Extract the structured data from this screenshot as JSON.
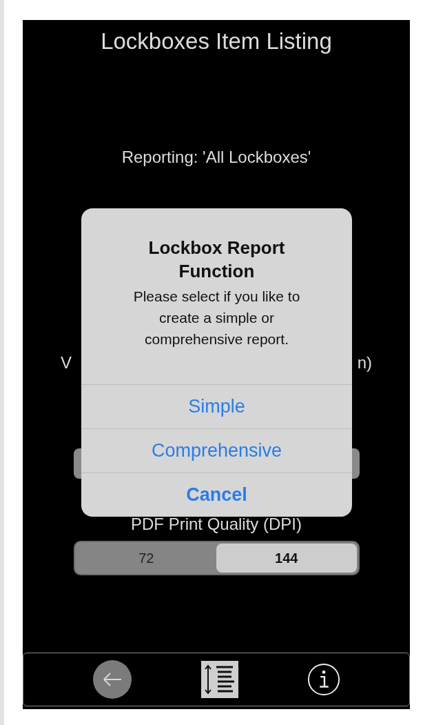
{
  "screen": {
    "title": "Lockboxes Item Listing",
    "reporting": "Reporting: 'All Lockboxes'",
    "hidden_label_fragments": [
      "V",
      "n)"
    ]
  },
  "dialog": {
    "title": "Lockbox Report Function",
    "message": "Please select if you like to create a simple or comprehensive report.",
    "actions": [
      {
        "label": "Simple",
        "kind": "normal"
      },
      {
        "label": "Comprehensive",
        "kind": "normal"
      },
      {
        "label": "Cancel",
        "kind": "cancel"
      }
    ]
  },
  "print_quality": {
    "label": "PDF Print Quality (DPI)",
    "segments": [
      {
        "label": "72",
        "selected": false
      },
      {
        "label": "144",
        "selected": true
      }
    ]
  },
  "toolbar": {
    "items": [
      {
        "kind": "back"
      },
      {
        "kind": "line-spacing"
      },
      {
        "kind": "info"
      }
    ]
  }
}
